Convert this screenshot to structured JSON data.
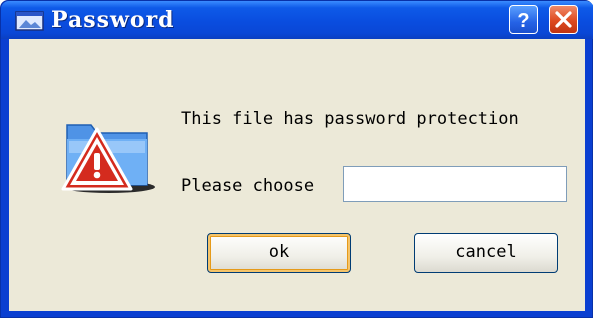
{
  "window": {
    "title": "Password",
    "help_button": "?",
    "close_button": "close"
  },
  "dialog": {
    "message": "This file has password protection",
    "prompt_label": "Please choose",
    "password_value": "",
    "ok_label": "ok",
    "cancel_label": "cancel"
  },
  "icons": {
    "title_icon": "window-icon",
    "main_icon": "folder-warning-icon"
  },
  "colors": {
    "titlebar_blue": "#0a4ddf",
    "client_bg": "#ece9d8",
    "close_red": "#de4a20"
  }
}
